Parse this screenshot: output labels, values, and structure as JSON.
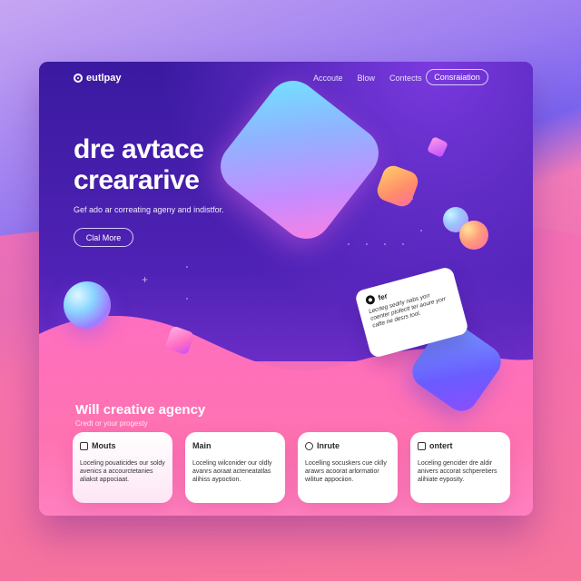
{
  "nav": {
    "logo": "eutlpay",
    "links": [
      "Accoute",
      "Blow",
      "Contects"
    ],
    "cta": "Consraiation"
  },
  "hero": {
    "title_line1": "dre avtace",
    "title_line2": "creararive",
    "subtitle": "Gef ado ar correating ageny and indistfor.",
    "button": "Clal More"
  },
  "note": {
    "label": "fer",
    "text": "Lecrteg sedrly nabs yorr coenter ptofectt ter aoure yorr cafte ne desrs tool."
  },
  "section": {
    "title": "Will creative agency",
    "subtitle": "Credt or your progesty"
  },
  "cards": [
    {
      "title": "Mouts",
      "icon": "document-icon",
      "text": "Loceling pouaticides our soldy avenics a accourctetanies aliakst appociaat."
    },
    {
      "title": "Main",
      "icon": "none",
      "text": "Loceling wilconider our oldly avanrs aoraat acteneatatlas alihiss aypoction."
    },
    {
      "title": "Inrute",
      "icon": "settings-icon",
      "text": "Locelling socuskers cue cklly arawrs acoorat arlormatior wilitue appociion."
    },
    {
      "title": "ontert",
      "icon": "chat-icon",
      "text": "Loceling gencider dre aldir anivers accorat schperetiers alihiate eyposity."
    }
  ],
  "colors": {
    "hero_top": "#3a1aa0",
    "pink": "#ff72b1",
    "accent_diamond_from": "#6ee6ff",
    "accent_diamond_to": "#ff7fe1"
  }
}
